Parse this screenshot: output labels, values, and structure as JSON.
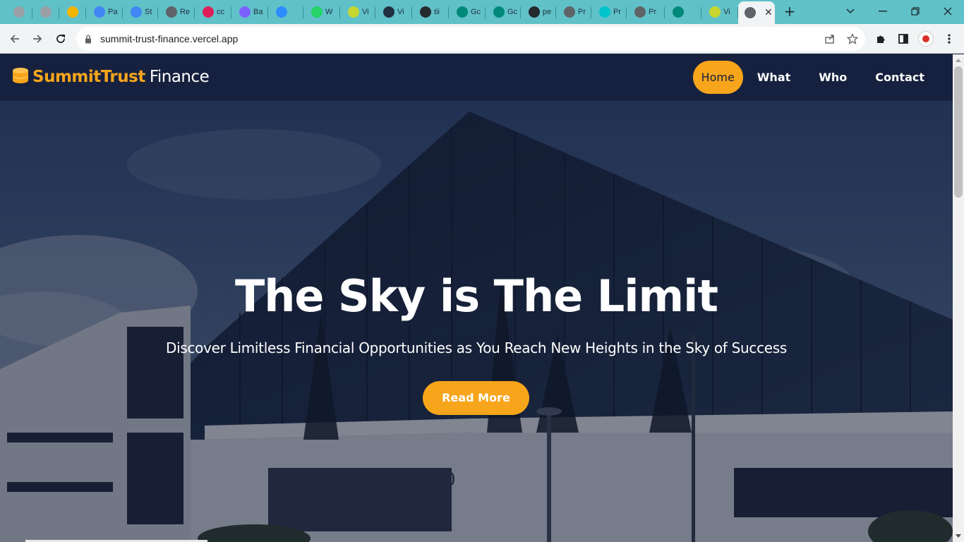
{
  "browser": {
    "tabs": [
      {
        "label": "",
        "favicon": "globe-icon",
        "color": "#9aa0a6"
      },
      {
        "label": "",
        "favicon": "globe-icon",
        "color": "#9aa0a6"
      },
      {
        "label": "",
        "favicon": "drive-icon",
        "color": "#f4b400"
      },
      {
        "label": "Pa",
        "favicon": "google-icon",
        "color": "#4285f4"
      },
      {
        "label": "St",
        "favicon": "google-icon",
        "color": "#4285f4"
      },
      {
        "label": "Re",
        "favicon": "globe-icon",
        "color": "#5f6368"
      },
      {
        "label": "cc",
        "favicon": "slack-icon",
        "color": "#e01e5a"
      },
      {
        "label": "Ba",
        "favicon": "sparkle-icon",
        "color": "#7b61ff"
      },
      {
        "label": "",
        "favicon": "zoom-icon",
        "color": "#2d8cff"
      },
      {
        "label": "W",
        "favicon": "whatsapp-icon",
        "color": "#25d366"
      },
      {
        "label": "Vi",
        "favicon": "v-icon",
        "color": "#c6d62e"
      },
      {
        "label": "Vi",
        "favicon": "vt-icon",
        "color": "#203040"
      },
      {
        "label": "tii",
        "favicon": "github-icon",
        "color": "#24292e"
      },
      {
        "label": "Gc",
        "favicon": "meet-icon",
        "color": "#00897b"
      },
      {
        "label": "Gc",
        "favicon": "meet-icon",
        "color": "#00897b"
      },
      {
        "label": "pe",
        "favicon": "github-icon",
        "color": "#24292e"
      },
      {
        "label": "Pr",
        "favicon": "globe-icon",
        "color": "#5f6368"
      },
      {
        "label": "Pr",
        "favicon": "canva-icon",
        "color": "#00c4cc"
      },
      {
        "label": "Pr",
        "favicon": "globe-icon",
        "color": "#5f6368"
      },
      {
        "label": "",
        "favicon": "meet-icon",
        "color": "#00897b"
      },
      {
        "label": "Vi",
        "favicon": "v-icon",
        "color": "#c6d62e"
      }
    ],
    "active_tab": {
      "label": "",
      "favicon": "globe-icon"
    },
    "new_tab_label": "+",
    "url": "summit-trust-finance.vercel.app"
  },
  "site": {
    "brand_primary": "SummitTrust",
    "brand_secondary": "Finance",
    "accent_color": "#f7a51b",
    "nav_bg": "#16213f",
    "nav": [
      {
        "label": "Home",
        "active": true
      },
      {
        "label": "What",
        "active": false
      },
      {
        "label": "Who",
        "active": false
      },
      {
        "label": "Contact",
        "active": false
      }
    ],
    "hero": {
      "title": "The Sky is The Limit",
      "subtitle": "Discover Limitless Financial Opportunities as You Reach New Heights in the Sky of Success",
      "cta": "Read More",
      "building_number": "15120"
    }
  }
}
